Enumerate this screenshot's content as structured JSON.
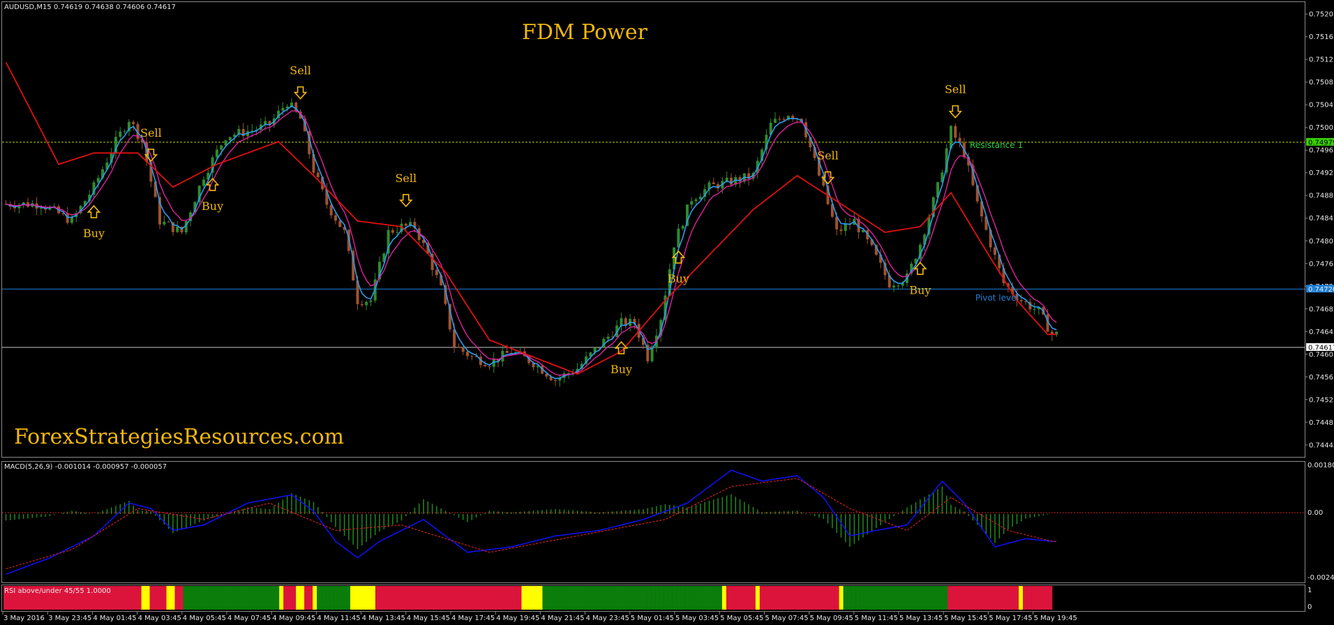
{
  "main_header": "AUDUSD,M15  0.74619 0.74638 0.74606 0.74617",
  "title": "FDM Power",
  "watermark": "ForexStrategiesResources.com",
  "macd_header": "MACD(5,26,9) -0.001014 -0.000957 -0.000057",
  "rsi_header": "RSI above/under 45/55 1.0000",
  "resistance_label": "Resistance 1",
  "pivot_label": "Pivot level",
  "price_axis": [
    "0.75205",
    "0.75165",
    "0.75125",
    "0.75085",
    "0.75045",
    "0.75005",
    "0.74965",
    "0.74925",
    "0.74885",
    "0.74845",
    "0.74805",
    "0.74765",
    "0.74725",
    "0.74685",
    "0.74645",
    "0.74605",
    "0.74565",
    "0.74525",
    "0.74485",
    "0.74445"
  ],
  "price_tags": {
    "resistance": "0.74979",
    "pivot": "0.74720",
    "current": "0.74617"
  },
  "macd_axis": [
    "0.001805",
    "0.00",
    "-0.002474"
  ],
  "rsi_axis": [
    "1",
    "0"
  ],
  "time_axis": [
    "3 May 2016",
    "3 May 23:45",
    "4 May 01:45",
    "4 May 03:45",
    "4 May 05:45",
    "4 May 07:45",
    "4 May 09:45",
    "4 May 11:45",
    "4 May 13:45",
    "4 May 15:45",
    "4 May 17:45",
    "4 May 19:45",
    "4 May 21:45",
    "4 May 23:45",
    "5 May 01:45",
    "5 May 03:45",
    "5 May 05:45",
    "5 May 07:45",
    "5 May 09:45",
    "5 May 11:45",
    "5 May 13:45",
    "5 May 15:45",
    "5 May 17:45",
    "5 May 19:45"
  ],
  "colors": {
    "bull": "#2e8b2e",
    "bear": "#a0522d",
    "fast_ma": "#2a9df4",
    "mid_ma": "#e020a0",
    "slow_ma": "#e01010",
    "resistance": "#b7d000",
    "pivot": "#1e7fd6",
    "current": "#c8c8c8",
    "signal": "#f2b80c",
    "macd_line": "#1010ff",
    "macd_signal": "#d02020",
    "rsi_red": "#dc143c",
    "rsi_yellow": "#ffff00",
    "rsi_green": "#0a7d0a",
    "axis_text": "#e6e6e6"
  },
  "chart_data": {
    "type": "candlestick",
    "symbol": "AUDUSD",
    "timeframe": "M15",
    "ylim": [
      0.7443,
      0.7522
    ],
    "levels": {
      "resistance": 0.74979,
      "pivot": 0.7472,
      "current": 0.74617
    },
    "close_path": [
      [
        0,
        0.7487
      ],
      [
        8,
        0.7487
      ],
      [
        15,
        0.7484
      ],
      [
        20,
        0.749
      ],
      [
        25,
        0.7498
      ],
      [
        28,
        0.7502
      ],
      [
        31,
        0.7498
      ],
      [
        35,
        0.7484
      ],
      [
        40,
        0.7482
      ],
      [
        45,
        0.7492
      ],
      [
        50,
        0.7499
      ],
      [
        56,
        0.75
      ],
      [
        60,
        0.7501
      ],
      [
        64,
        0.7505
      ],
      [
        67,
        0.7502
      ],
      [
        70,
        0.7493
      ],
      [
        73,
        0.7487
      ],
      [
        77,
        0.7482
      ],
      [
        80,
        0.747
      ],
      [
        83,
        0.747
      ],
      [
        87,
        0.7482
      ],
      [
        90,
        0.7483
      ],
      [
        93,
        0.7483
      ],
      [
        96,
        0.7478
      ],
      [
        99,
        0.7472
      ],
      [
        102,
        0.7462
      ],
      [
        106,
        0.746
      ],
      [
        110,
        0.7459
      ],
      [
        115,
        0.7461
      ],
      [
        120,
        0.7459
      ],
      [
        125,
        0.7456
      ],
      [
        130,
        0.7458
      ],
      [
        135,
        0.7462
      ],
      [
        140,
        0.7466
      ],
      [
        143,
        0.7466
      ],
      [
        146,
        0.746
      ],
      [
        149,
        0.7467
      ],
      [
        152,
        0.748
      ],
      [
        156,
        0.7488
      ],
      [
        160,
        0.749
      ],
      [
        165,
        0.7491
      ],
      [
        170,
        0.7492
      ],
      [
        174,
        0.7501
      ],
      [
        178,
        0.7503
      ],
      [
        181,
        0.7502
      ],
      [
        185,
        0.7492
      ],
      [
        189,
        0.7482
      ],
      [
        193,
        0.7484
      ],
      [
        197,
        0.7479
      ],
      [
        201,
        0.7473
      ],
      [
        205,
        0.7474
      ],
      [
        208,
        0.748
      ],
      [
        212,
        0.749
      ],
      [
        215,
        0.75
      ],
      [
        218,
        0.7496
      ],
      [
        221,
        0.7487
      ],
      [
        224,
        0.748
      ],
      [
        227,
        0.7473
      ],
      [
        231,
        0.747
      ],
      [
        235,
        0.7468
      ],
      [
        238,
        0.7464
      ]
    ],
    "slow_ma_path": [
      [
        0,
        0.7512
      ],
      [
        12,
        0.7494
      ],
      [
        20,
        0.7496
      ],
      [
        30,
        0.7496
      ],
      [
        38,
        0.749
      ],
      [
        48,
        0.7494
      ],
      [
        55,
        0.7496
      ],
      [
        62,
        0.7498
      ],
      [
        70,
        0.7492
      ],
      [
        80,
        0.7484
      ],
      [
        90,
        0.7483
      ],
      [
        100,
        0.7475
      ],
      [
        110,
        0.7463
      ],
      [
        120,
        0.746
      ],
      [
        130,
        0.7457
      ],
      [
        140,
        0.7461
      ],
      [
        150,
        0.747
      ],
      [
        160,
        0.7478
      ],
      [
        170,
        0.7486
      ],
      [
        180,
        0.7492
      ],
      [
        190,
        0.7487
      ],
      [
        200,
        0.7482
      ],
      [
        208,
        0.7483
      ],
      [
        215,
        0.7489
      ],
      [
        222,
        0.748
      ],
      [
        230,
        0.747
      ],
      [
        237,
        0.7464
      ]
    ],
    "signals": [
      {
        "type": "Sell",
        "bar": 33
      },
      {
        "type": "Buy",
        "bar": 20
      },
      {
        "type": "Buy",
        "bar": 47
      },
      {
        "type": "Sell",
        "bar": 67
      },
      {
        "type": "Sell",
        "bar": 91
      },
      {
        "type": "Buy",
        "bar": 140
      },
      {
        "type": "Buy",
        "bar": 153
      },
      {
        "type": "Sell",
        "bar": 187
      },
      {
        "type": "Buy",
        "bar": 208
      },
      {
        "type": "Sell",
        "bar": 216
      }
    ],
    "macd": {
      "ylim": [
        -0.002474,
        0.001805
      ],
      "main_path": [
        [
          0,
          -0.0022
        ],
        [
          10,
          -0.0016
        ],
        [
          20,
          -0.0008
        ],
        [
          28,
          0.0004
        ],
        [
          33,
          0.0002
        ],
        [
          38,
          -0.0006
        ],
        [
          45,
          -0.0004
        ],
        [
          55,
          0.0004
        ],
        [
          65,
          0.0007
        ],
        [
          70,
          0.0001
        ],
        [
          75,
          -0.001
        ],
        [
          80,
          -0.0016
        ],
        [
          85,
          -0.001
        ],
        [
          95,
          -0.0002
        ],
        [
          105,
          -0.0014
        ],
        [
          115,
          -0.0012
        ],
        [
          125,
          -0.0008
        ],
        [
          135,
          -0.0006
        ],
        [
          145,
          -0.0002
        ],
        [
          155,
          0.0004
        ],
        [
          165,
          0.0016
        ],
        [
          172,
          0.0012
        ],
        [
          180,
          0.0014
        ],
        [
          186,
          0.0006
        ],
        [
          192,
          -0.0008
        ],
        [
          198,
          -0.0006
        ],
        [
          205,
          -0.0004
        ],
        [
          213,
          0.0012
        ],
        [
          218,
          0.0004
        ],
        [
          225,
          -0.0012
        ],
        [
          232,
          -0.0009
        ],
        [
          238,
          -0.001
        ]
      ],
      "signal_path": [
        [
          0,
          -0.002
        ],
        [
          15,
          -0.0013
        ],
        [
          30,
          0.0002
        ],
        [
          45,
          -0.0002
        ],
        [
          60,
          0.0004
        ],
        [
          75,
          -0.0006
        ],
        [
          90,
          -0.0004
        ],
        [
          110,
          -0.0014
        ],
        [
          130,
          -0.0008
        ],
        [
          150,
          -0.0002
        ],
        [
          165,
          0.001
        ],
        [
          180,
          0.0013
        ],
        [
          192,
          0.0002
        ],
        [
          205,
          -0.0006
        ],
        [
          215,
          0.0006
        ],
        [
          228,
          -0.0006
        ],
        [
          238,
          -0.001
        ]
      ]
    },
    "rsi_bars": "RRRRRRRRRRRRRRRRRRRRRRRRRRRRRRRRRYYRRRRYYRRGGGGGGGGGGGGGGGGGGGGGGGYRRRYYRRYGGGGGGGGYYYYYYRRRRRRRRRRRRRRRRRRRRRRRRRRRRRRRRRRRYYYYYGGGGGGGGGGGGGGGGGGGGGGGGGGGGGGGGGGGGGGGGGGGYRRRRRRRYRRRRRRRRRRRRRRRRRRRYGGGGGGGGGGGGGGGGGGGGGGGGGRRRRRRRRRRRRRRRRRYRRRRRRR"
  }
}
